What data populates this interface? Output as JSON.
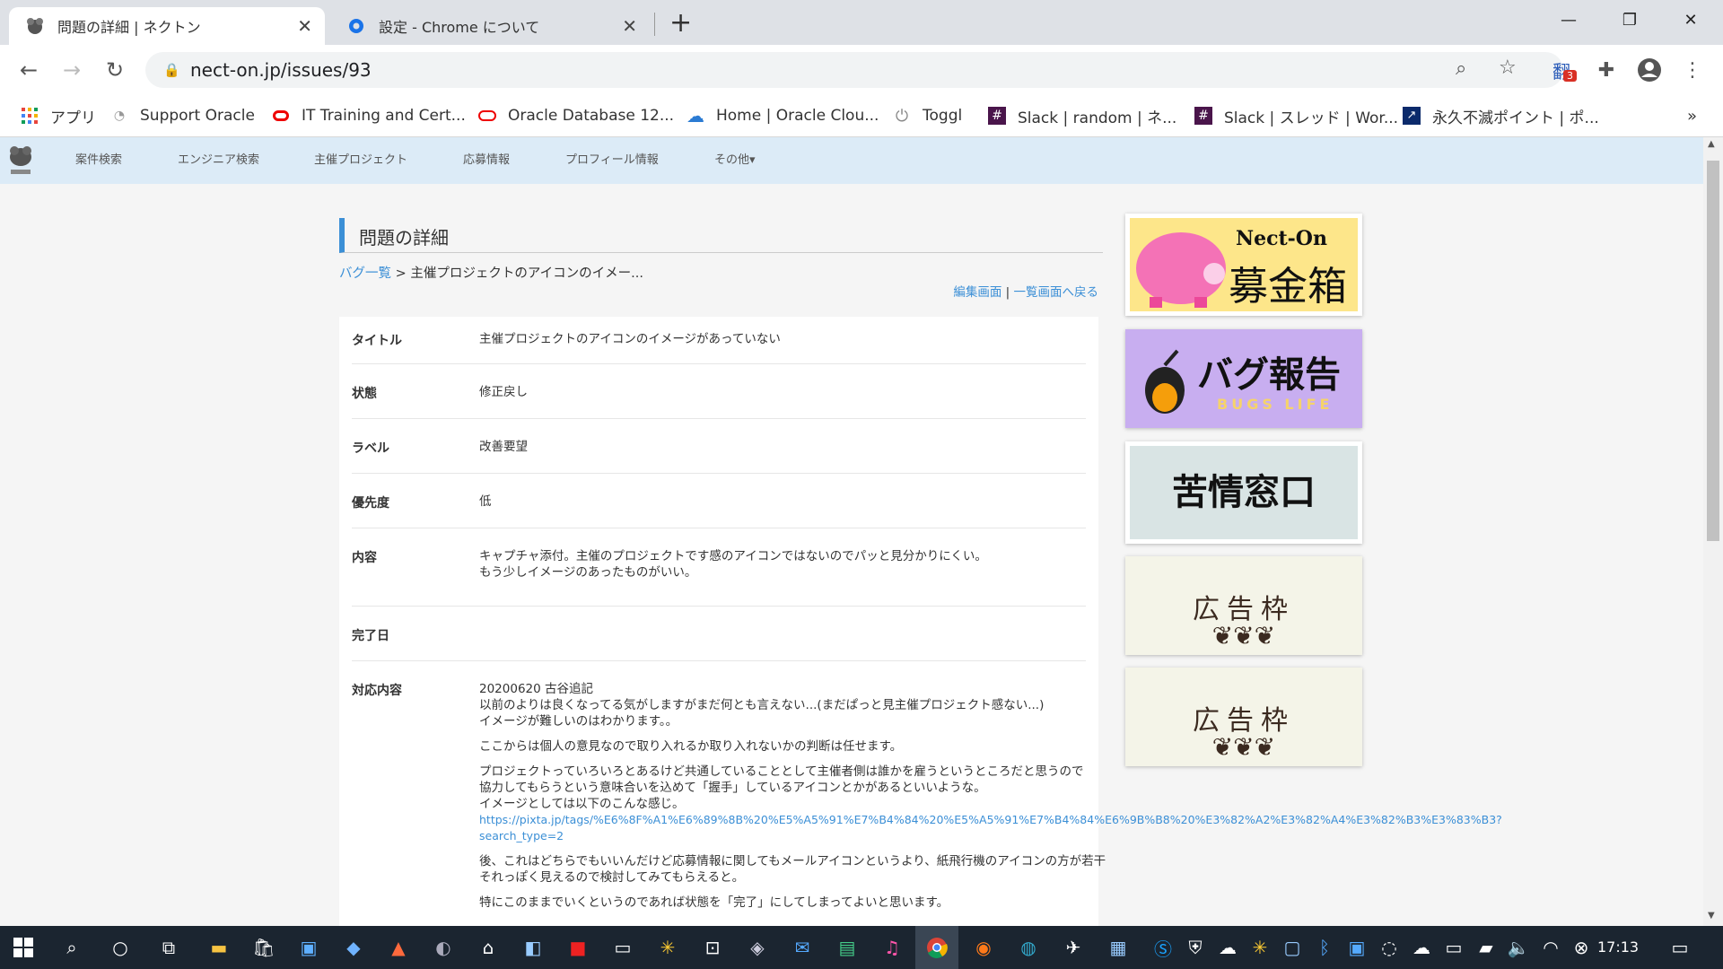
{
  "browser": {
    "tabs": [
      {
        "title": "問題の詳細 | ネクトン",
        "active": true
      },
      {
        "title": "設定 - Chrome について",
        "active": false
      }
    ],
    "url": "nect-on.jp/issues/93",
    "extension_badge": "3",
    "bookmarks": [
      {
        "label": "アプリ",
        "icon": "apps-grid-icon"
      },
      {
        "label": "Support Oracle",
        "icon": "support-icon"
      },
      {
        "label": "IT Training and Cert...",
        "icon": "oracle-icon"
      },
      {
        "label": "Oracle Database 12...",
        "icon": "oracle-ring-icon"
      },
      {
        "label": "Home | Oracle Clou...",
        "icon": "cloud-icon"
      },
      {
        "label": "Toggl",
        "icon": "power-icon"
      },
      {
        "label": "Slack | random | ネ...",
        "icon": "slack-icon"
      },
      {
        "label": "Slack | スレッド | Wor...",
        "icon": "slack-icon"
      },
      {
        "label": "永久不滅ポイント | ポ...",
        "icon": "chart-icon"
      }
    ],
    "more_bookmarks": "»"
  },
  "site_nav": {
    "items": [
      "案件検索",
      "エンジニア検索",
      "主催プロジェクト",
      "応募情報",
      "プロフィール情報",
      "その他▾"
    ]
  },
  "page": {
    "title": "問題の詳細",
    "breadcrumb_link": "バグ一覧",
    "breadcrumb_sep": ">",
    "breadcrumb_current": "主催プロジェクトのアイコンのイメー...",
    "edit_link": "編集画面",
    "link_sep": "|",
    "back_link": "一覧画面へ戻る",
    "fields": {
      "title": {
        "label": "タイトル",
        "value": "主催プロジェクトのアイコンのイメージがあっていない"
      },
      "status": {
        "label": "状態",
        "value": "修正戻し"
      },
      "tag": {
        "label": "ラベル",
        "value": "改善要望"
      },
      "priority": {
        "label": "優先度",
        "value": "低"
      },
      "content": {
        "label": "内容",
        "line1": "キャプチャ添付。主催のプロジェクトです感のアイコンではないのでパッと見分かりにくい。",
        "line2": "もう少しイメージのあったものがいい。"
      },
      "done_date": {
        "label": "完了日",
        "value": ""
      },
      "response": {
        "label": "対応内容",
        "p1_l1": "20200620 古谷追記",
        "p1_l2": "以前のよりは良くなってる気がしますがまだ何とも言えない...(まだぱっと見主催プロジェクト感ない...)",
        "p1_l3": "イメージが難しいのはわかります。。",
        "p2": "ここからは個人の意見なので取り入れるか取り入れないかの判断は任せます。",
        "p3_l1": "プロジェクトっていろいろとあるけど共通していることとして主催者側は誰かを雇うというところだと思うので",
        "p3_l2": "協力してもらうという意味合いを込めて「握手」しているアイコンとかがあるといいような。",
        "p3_l3": "イメージとしては以下のこんな感じ。",
        "link_l1": "https://pixta.jp/tags/%E6%8F%A1%E6%89%8B%20%E5%A5%91%E7%B4%84%20%E5%A5%91%E7%B4%84%E6%9B%B8%20%E3%82%A2%E3%82%A4%E3%82%B3%E3%83%B3?",
        "link_l2": "search_type=2",
        "p4_l1": "後、これはどちらでもいいんだけど応募情報に関してもメールアイコンというより、紙飛行機のアイコンの方が若干",
        "p4_l2": "それっぽく見えるので検討してみてもらえると。",
        "p5": "特にこのままでいくというのであれば状態を「完了」にしてしまってよいと思います。"
      }
    }
  },
  "sidebar": {
    "donation": {
      "brand": "Nect-On",
      "label": "募金箱"
    },
    "bug_report": {
      "label": "バグ報告",
      "sub": "BUGS LIFE"
    },
    "complaint": {
      "label": "苦情窓口"
    },
    "ad1": {
      "label": "広告枠"
    },
    "ad2": {
      "label": "広告枠"
    }
  },
  "taskbar": {
    "clock": "17:13"
  },
  "colors": {
    "accent": "#3b8fd6",
    "nav_bg": "#dcebf7",
    "taskbar_bg": "#1b2530"
  }
}
